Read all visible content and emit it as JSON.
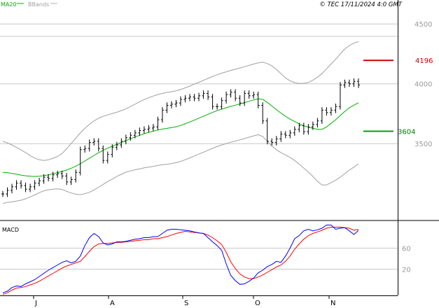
{
  "header": {
    "legend_ma": "MA20",
    "legend_bbands": "BBands",
    "copyright": "© TEC 17/11/2024 4:0 GMT"
  },
  "colors": {
    "background": "#ffffff",
    "grid": "#c8c8c8",
    "price": "#000000",
    "ma20": "#00b000",
    "bands": "#a0a0a0",
    "macd": "#0000ff",
    "signal": "#ff0000",
    "resistance": "#cc0000",
    "support": "#00a000",
    "axis_text": "#9a9a9a",
    "resistance_text": "#cc0000",
    "support_text": "#008000"
  },
  "chart_data": [
    {
      "type": "candlestick",
      "x_ticks": [
        "J",
        "A",
        "S",
        "O",
        "N"
      ],
      "y_ticks": [
        4500,
        4000,
        3500
      ],
      "y_tick_labels": [
        "4500",
        "4000",
        "3500"
      ],
      "ylim": [
        2870,
        4700
      ],
      "grid": true,
      "levels": [
        {
          "label": "4196",
          "value": 4196,
          "kind": "resistance"
        },
        {
          "label": "3604",
          "value": 3604,
          "kind": "support"
        }
      ],
      "series": [
        {
          "name": "MA20",
          "values": [
            3260,
            3258,
            3252,
            3245,
            3238,
            3232,
            3228,
            3226,
            3228,
            3233,
            3240,
            3249,
            3258,
            3268,
            3280,
            3295,
            3312,
            3332,
            3355,
            3378,
            3402,
            3424,
            3444,
            3462,
            3478,
            3494,
            3510,
            3526,
            3541,
            3556,
            3570,
            3583,
            3594,
            3604,
            3614,
            3622,
            3628,
            3634,
            3641,
            3652,
            3666,
            3681,
            3697,
            3713,
            3729,
            3745,
            3761,
            3776,
            3789,
            3800,
            3812,
            3822,
            3832,
            3843,
            3854,
            3865,
            3875,
            3870,
            3845,
            3815,
            3785,
            3755,
            3728,
            3705,
            3685,
            3666,
            3650,
            3638,
            3628,
            3620,
            3620,
            3640,
            3670,
            3700,
            3735,
            3770,
            3800,
            3822,
            3842
          ]
        },
        {
          "name": "BBands",
          "values": [
            3520,
            3506,
            3490,
            3470,
            3448,
            3425,
            3400,
            3380,
            3365,
            3360,
            3365,
            3378,
            3393,
            3418,
            3458,
            3502,
            3546,
            3590,
            3628,
            3662,
            3690,
            3712,
            3728,
            3740,
            3752,
            3762,
            3776,
            3790,
            3810,
            3830,
            3850,
            3868,
            3884,
            3898,
            3910,
            3920,
            3928,
            3934,
            3941,
            3952,
            3966,
            3981,
            3997,
            4013,
            4029,
            4045,
            4061,
            4076,
            4089,
            4100,
            4112,
            4122,
            4132,
            4143,
            4154,
            4165,
            4175,
            4180,
            4170,
            4150,
            4120,
            4085,
            4050,
            4025,
            4010,
            4003,
            4004,
            4012,
            4030,
            4055,
            4085,
            4125,
            4165,
            4205,
            4250,
            4290,
            4320,
            4340,
            4352
          ]
        },
        {
          "name": "BBands lower",
          "values": [
            3000,
            3010,
            3014,
            3020,
            3028,
            3039,
            3056,
            3072,
            3091,
            3106,
            3115,
            3120,
            3123,
            3118,
            3102,
            3088,
            3078,
            3074,
            3082,
            3094,
            3114,
            3136,
            3160,
            3184,
            3204,
            3226,
            3244,
            3262,
            3272,
            3282,
            3290,
            3298,
            3304,
            3310,
            3318,
            3324,
            3328,
            3334,
            3341,
            3352,
            3366,
            3381,
            3397,
            3413,
            3429,
            3445,
            3461,
            3476,
            3489,
            3500,
            3512,
            3522,
            3532,
            3543,
            3554,
            3565,
            3575,
            3560,
            3520,
            3480,
            3450,
            3425,
            3406,
            3385,
            3360,
            3329,
            3296,
            3264,
            3226,
            3185,
            3155,
            3155,
            3175,
            3195,
            3220,
            3250,
            3280,
            3304,
            3332
          ]
        },
        {
          "name": "Close",
          "values": [
            3080,
            3110,
            3140,
            3170,
            3150,
            3120,
            3140,
            3170,
            3190,
            3220,
            3210,
            3240,
            3250,
            3230,
            3180,
            3200,
            3260,
            3450,
            3460,
            3510,
            3520,
            3460,
            3360,
            3410,
            3470,
            3490,
            3520,
            3550,
            3570,
            3590,
            3610,
            3620,
            3630,
            3640,
            3700,
            3780,
            3820,
            3830,
            3840,
            3870,
            3880,
            3890,
            3880,
            3900,
            3920,
            3890,
            3810,
            3810,
            3860,
            3910,
            3930,
            3880,
            3840,
            3920,
            3900,
            3910,
            3820,
            3690,
            3520,
            3510,
            3540,
            3580,
            3570,
            3590,
            3620,
            3650,
            3600,
            3640,
            3660,
            3690,
            3780,
            3760,
            3780,
            3810,
            3990,
            4010,
            4000,
            4020,
            3990
          ]
        }
      ]
    },
    {
      "type": "line",
      "title": "MACD",
      "y_ticks": [
        60,
        20
      ],
      "y_tick_labels": [
        "60",
        "20"
      ],
      "ylim": [
        -30,
        110
      ],
      "grid": true,
      "series": [
        {
          "name": "MACD",
          "values": [
            -25,
            -22,
            -15,
            -12,
            -13,
            -8,
            -4,
            0,
            6,
            12,
            18,
            23,
            28,
            33,
            36,
            32,
            35,
            45,
            65,
            80,
            88,
            82,
            70,
            66,
            68,
            72,
            72,
            73,
            75,
            77,
            78,
            80,
            80,
            82,
            82,
            88,
            94,
            96,
            96,
            95,
            94,
            93,
            91,
            89,
            88,
            80,
            72,
            65,
            56,
            30,
            8,
            -2,
            -9,
            -8,
            -3,
            3,
            13,
            18,
            25,
            29,
            35,
            33,
            45,
            60,
            78,
            84,
            93,
            96,
            93,
            95,
            98,
            104,
            104,
            96,
            98,
            99,
            93,
            86,
            94
          ]
        },
        {
          "name": "Signal",
          "values": [
            -28,
            -25,
            -20,
            -16,
            -15,
            -13,
            -10,
            -7,
            -3,
            2,
            7,
            12,
            17,
            22,
            26,
            29,
            32,
            35,
            44,
            54,
            63,
            68,
            69,
            69,
            70,
            71,
            71,
            72,
            73,
            74,
            75,
            76,
            76,
            78,
            78,
            80,
            82,
            85,
            88,
            90,
            92,
            91,
            90,
            89,
            88,
            85,
            80,
            74,
            67,
            52,
            34,
            21,
            11,
            5,
            2,
            2,
            5,
            9,
            14,
            19,
            24,
            28,
            35,
            45,
            58,
            68,
            77,
            84,
            88,
            91,
            94,
            98,
            100,
            100,
            100,
            99,
            98,
            94,
            96
          ]
        }
      ]
    }
  ]
}
